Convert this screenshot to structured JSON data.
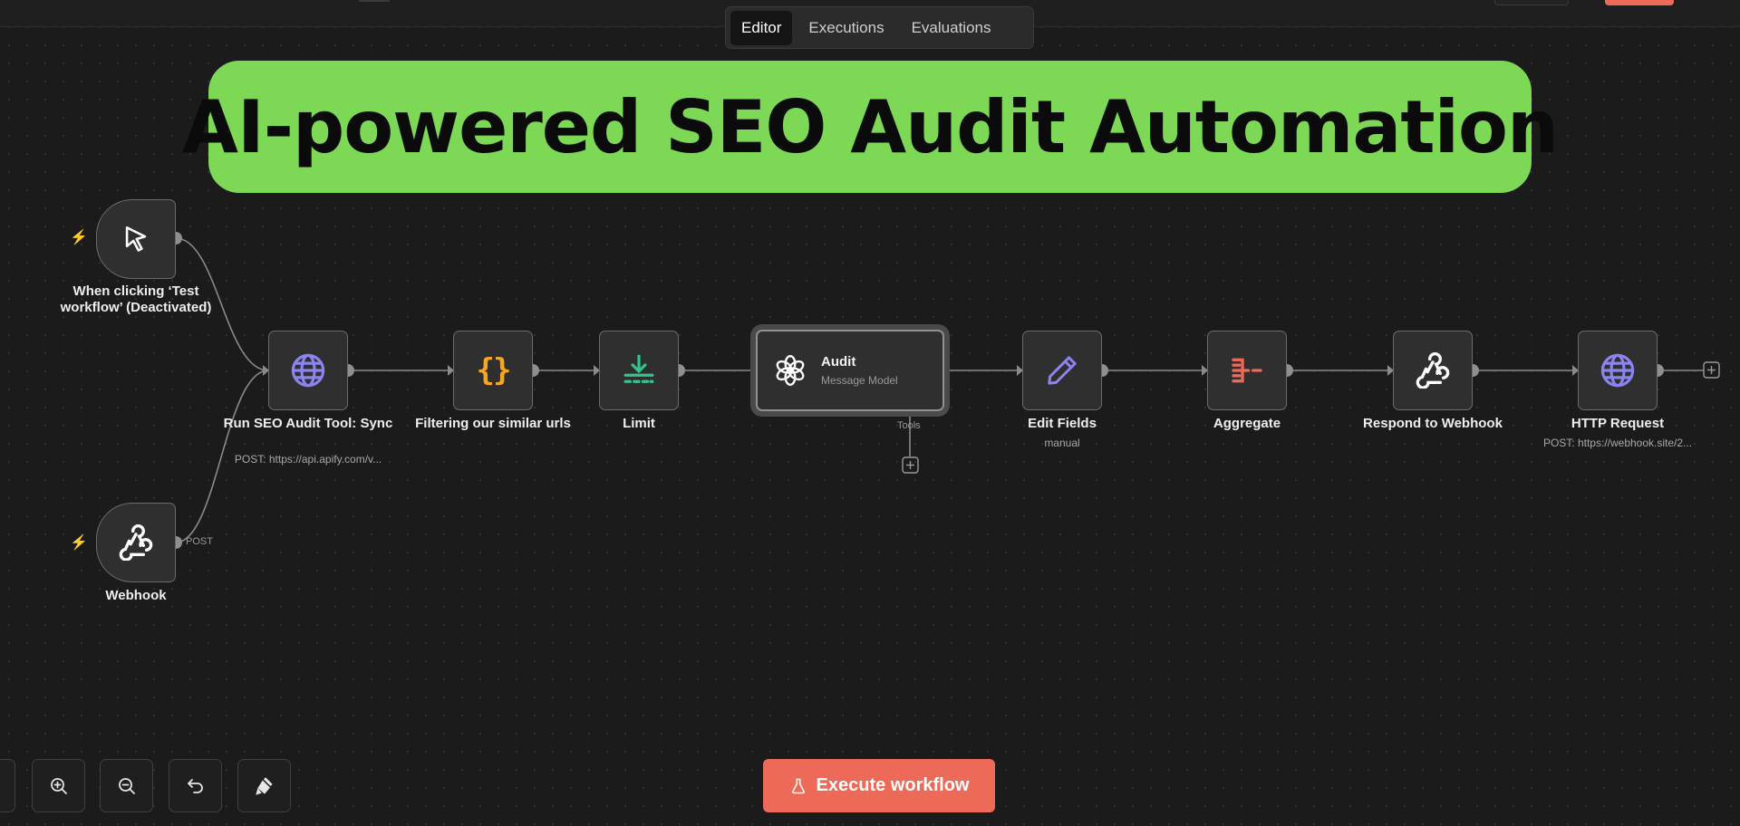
{
  "tabs": [
    {
      "label": "Editor",
      "active": true
    },
    {
      "label": "Executions",
      "active": false
    },
    {
      "label": "Evaluations",
      "active": false
    }
  ],
  "banner": {
    "text": "AI-powered SEO Audit Automation",
    "color": "#7dd855"
  },
  "nodes": {
    "manual_trigger": {
      "label": "When clicking ‘Test workflow’ (Deactivated)",
      "icon": "cursor-icon"
    },
    "webhook": {
      "label": "Webhook",
      "output_label": "POST",
      "icon": "webhook-icon"
    },
    "seo_audit": {
      "label": "Run SEO Audit Tool: Sync",
      "subtitle": "POST: https://api.apify.com/v...",
      "icon": "globe-icon"
    },
    "filter": {
      "label": "Filtering our similar urls",
      "icon": "code-braces-icon"
    },
    "limit": {
      "label": "Limit",
      "icon": "limit-icon"
    },
    "audit": {
      "title": "Audit",
      "subtitle": "Message Model",
      "connector_label": "Tools",
      "icon": "openai-icon"
    },
    "edit_fields": {
      "label": "Edit Fields",
      "subtitle": "manual",
      "icon": "pencil-icon"
    },
    "aggregate": {
      "label": "Aggregate",
      "icon": "aggregate-icon"
    },
    "respond": {
      "label": "Respond to Webhook",
      "icon": "webhook-icon"
    },
    "http_request": {
      "label": "HTTP Request",
      "subtitle": "POST: https://webhook.site/2...",
      "icon": "globe-icon"
    }
  },
  "controls": {
    "execute_label": "Execute workflow",
    "buttons": [
      "zoom-in-icon",
      "zoom-out-icon",
      "undo-icon",
      "clear-icon"
    ]
  },
  "colors": {
    "accent": "#ee6a58",
    "globe": "#8b84f0",
    "braces": "#f5a623",
    "limit": "#35c48b",
    "pencil": "#8b84f0",
    "aggregate": "#ee6a58"
  }
}
